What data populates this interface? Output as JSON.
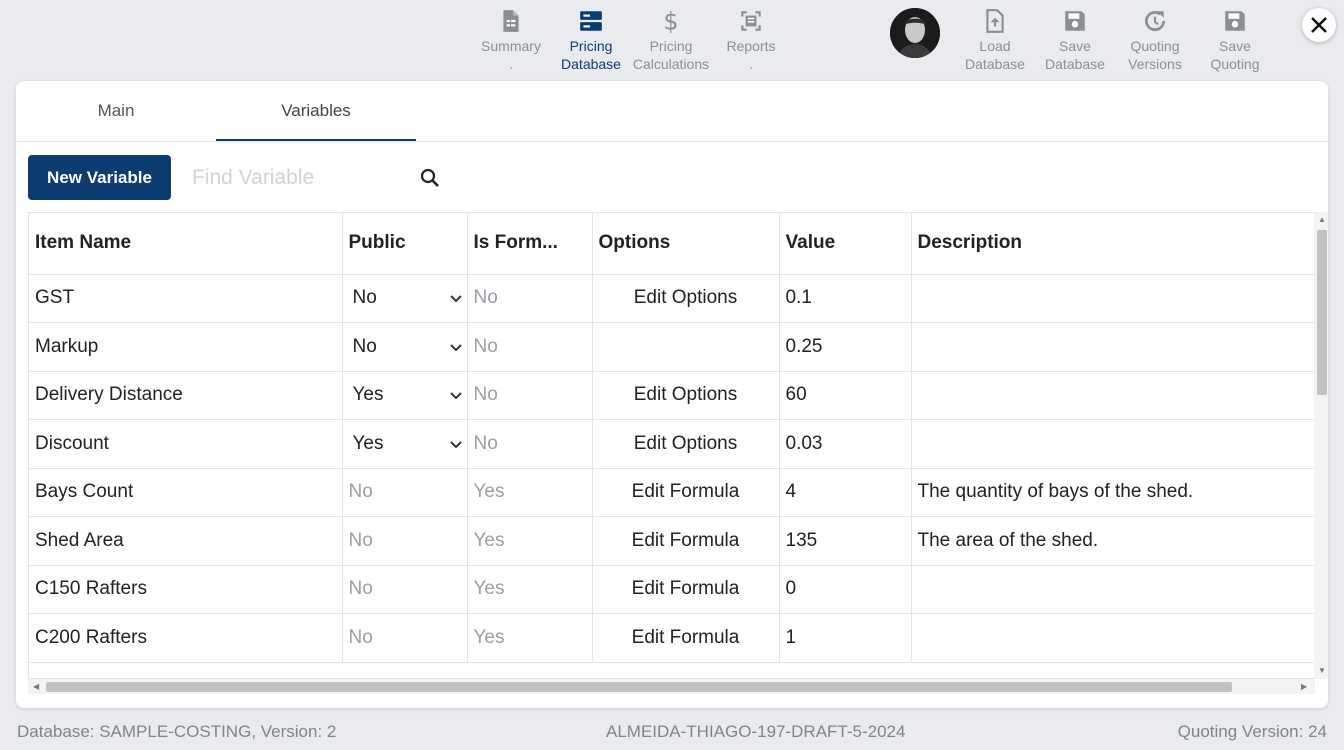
{
  "toolbar": {
    "summary": {
      "line1": "Summary",
      "line2": "."
    },
    "pricing_db": {
      "line1": "Pricing",
      "line2": "Database"
    },
    "pricing_calc": {
      "line1": "Pricing",
      "line2": "Calculations"
    },
    "reports": {
      "line1": "Reports",
      "line2": "."
    },
    "load_db": {
      "line1": "Load",
      "line2": "Database"
    },
    "save_db": {
      "line1": "Save",
      "line2": "Database"
    },
    "quoting_versions": {
      "line1": "Quoting",
      "line2": "Versions"
    },
    "save_quoting": {
      "line1": "Save",
      "line2": "Quoting"
    },
    "accent": "#0d3c70",
    "inactive_color": "#8a8f96"
  },
  "tabs": [
    {
      "label": "Main"
    },
    {
      "label": "Variables"
    }
  ],
  "actions": {
    "new_variable": "New Variable",
    "find_placeholder": "Find Variable"
  },
  "table": {
    "headers": [
      "Item Name",
      "Public",
      "Is Form...",
      "Options",
      "Value",
      "Description"
    ],
    "rows": [
      {
        "name": "GST",
        "public": "No",
        "public_select": true,
        "formula": "No",
        "options": "Edit Options",
        "value": "0.1",
        "description": ""
      },
      {
        "name": "Markup",
        "public": "No",
        "public_select": true,
        "formula": "No",
        "options": "",
        "value": "0.25",
        "description": ""
      },
      {
        "name": "Delivery Distance",
        "public": "Yes",
        "public_select": true,
        "formula": "No",
        "options": "Edit Options",
        "value": "60",
        "description": ""
      },
      {
        "name": "Discount",
        "public": "Yes",
        "public_select": true,
        "formula": "No",
        "options": "Edit Options",
        "value": "0.03",
        "description": ""
      },
      {
        "name": "Bays Count",
        "public": "No",
        "public_select": false,
        "formula": "Yes",
        "options": "Edit Formula",
        "value": "4",
        "description": "The quantity of bays of the shed."
      },
      {
        "name": "Shed Area",
        "public": "No",
        "public_select": false,
        "formula": "Yes",
        "options": "Edit Formula",
        "value": "135",
        "description": "The area of the shed."
      },
      {
        "name": "C150 Rafters",
        "public": "No",
        "public_select": false,
        "formula": "Yes",
        "options": "Edit Formula",
        "value": "0",
        "description": ""
      },
      {
        "name": "C200 Rafters",
        "public": "No",
        "public_select": false,
        "formula": "Yes",
        "options": "Edit Formula",
        "value": "1",
        "description": ""
      }
    ]
  },
  "footer": {
    "database": "Database: SAMPLE-COSTING, Version: 2",
    "quote_id": "ALMEIDA-THIAGO-197-DRAFT-5-2024",
    "quoting_version": "Quoting Version: 24"
  }
}
